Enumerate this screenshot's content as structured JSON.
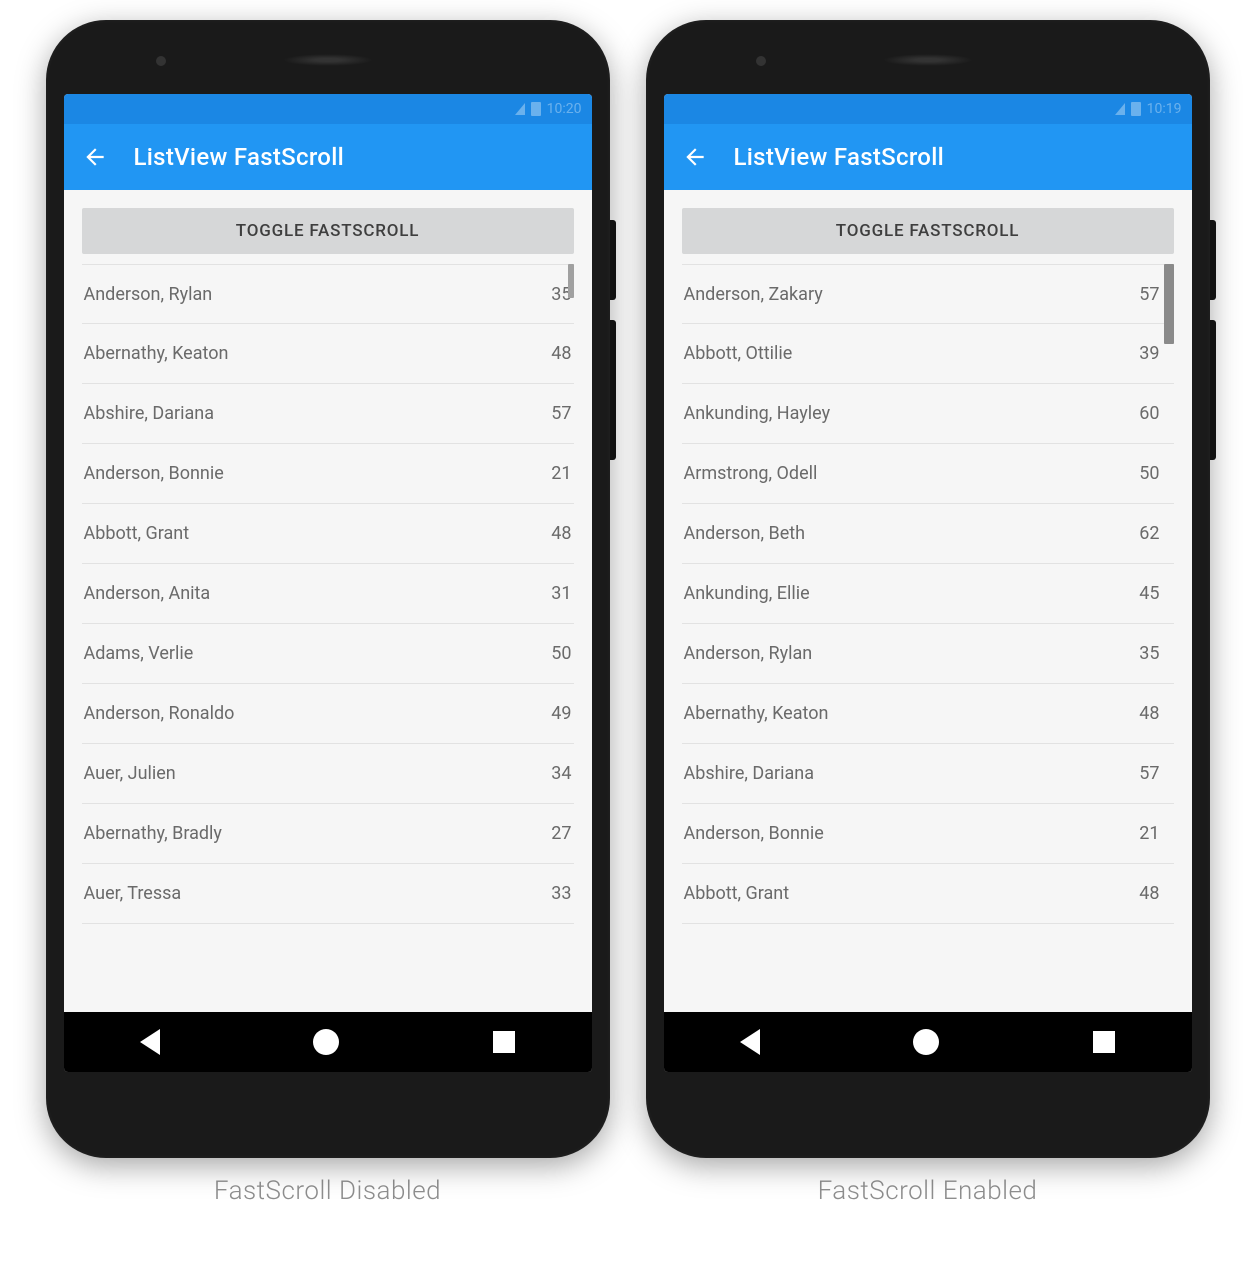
{
  "colors": {
    "statusbar": "#1b87e4",
    "appbar": "#2196f3",
    "button": "#d6d7d8"
  },
  "left": {
    "status_time": "10:20",
    "appbar_title": "ListView FastScroll",
    "toggle_label": "TOGGLE FASTSCROLL",
    "caption": "FastScroll Disabled",
    "items": [
      {
        "name": "Anderson, Rylan",
        "value": "35"
      },
      {
        "name": "Abernathy, Keaton",
        "value": "48"
      },
      {
        "name": "Abshire, Dariana",
        "value": "57"
      },
      {
        "name": "Anderson, Bonnie",
        "value": "21"
      },
      {
        "name": "Abbott, Grant",
        "value": "48"
      },
      {
        "name": "Anderson, Anita",
        "value": "31"
      },
      {
        "name": "Adams, Verlie",
        "value": "50"
      },
      {
        "name": "Anderson, Ronaldo",
        "value": "49"
      },
      {
        "name": "Auer, Julien",
        "value": "34"
      },
      {
        "name": "Abernathy, Bradly",
        "value": "27"
      },
      {
        "name": "Auer, Tressa",
        "value": "33"
      }
    ]
  },
  "right": {
    "status_time": "10:19",
    "appbar_title": "ListView FastScroll",
    "toggle_label": "TOGGLE FASTSCROLL",
    "caption": "FastScroll Enabled",
    "items": [
      {
        "name": "Anderson, Zakary",
        "value": "57"
      },
      {
        "name": "Abbott, Ottilie",
        "value": "39"
      },
      {
        "name": "Ankunding, Hayley",
        "value": "60"
      },
      {
        "name": "Armstrong, Odell",
        "value": "50"
      },
      {
        "name": "Anderson, Beth",
        "value": "62"
      },
      {
        "name": "Ankunding, Ellie",
        "value": "45"
      },
      {
        "name": "Anderson, Rylan",
        "value": "35"
      },
      {
        "name": "Abernathy, Keaton",
        "value": "48"
      },
      {
        "name": "Abshire, Dariana",
        "value": "57"
      },
      {
        "name": "Anderson, Bonnie",
        "value": "21"
      },
      {
        "name": "Abbott, Grant",
        "value": "48"
      }
    ]
  }
}
